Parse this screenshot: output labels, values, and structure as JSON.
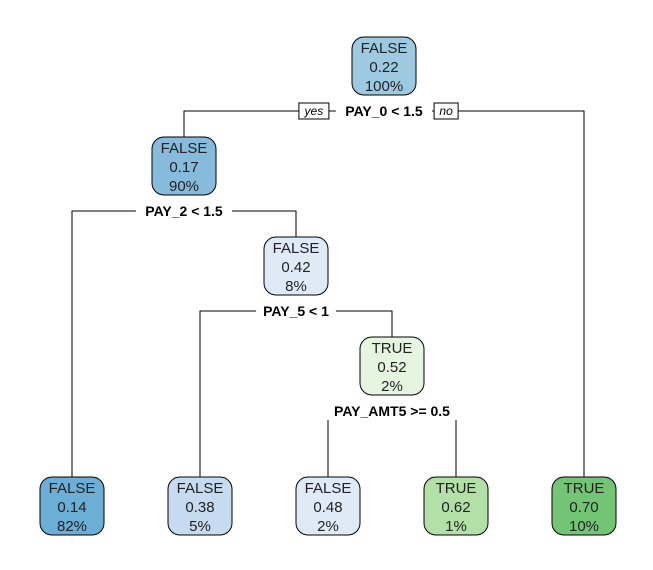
{
  "diagram": {
    "type": "decision-tree",
    "edge_labels": {
      "left": "yes",
      "right": "no"
    },
    "colors": {
      "false_1": "#6baed6",
      "false_2": "#86bbdc",
      "false_3": "#9ecae1",
      "false_4": "#c6dbef",
      "false_5": "#d0e1f2",
      "false_6": "#deebf7",
      "true_1": "#e5f5e0",
      "true_2": "#b3e0a6",
      "true_3": "#74c476"
    },
    "nodes": [
      {
        "id": "n1",
        "class": "FALSE",
        "prob": "0.22",
        "pct": "100%",
        "color": "false_3",
        "split": "PAY_0 < 1.5"
      },
      {
        "id": "n2",
        "class": "FALSE",
        "prob": "0.17",
        "pct": "90%",
        "color": "false_2",
        "split": "PAY_2 < 1.5"
      },
      {
        "id": "n3",
        "class": "TRUE",
        "prob": "0.70",
        "pct": "10%",
        "color": "true_3"
      },
      {
        "id": "n4",
        "class": "FALSE",
        "prob": "0.14",
        "pct": "82%",
        "color": "false_1"
      },
      {
        "id": "n5",
        "class": "FALSE",
        "prob": "0.42",
        "pct": "8%",
        "color": "false_6",
        "split": "PAY_5 < 1"
      },
      {
        "id": "n10",
        "class": "FALSE",
        "prob": "0.38",
        "pct": "5%",
        "color": "false_4"
      },
      {
        "id": "n11",
        "class": "TRUE",
        "prob": "0.52",
        "pct": "2%",
        "color": "true_1",
        "split": "PAY_AMT5 >= 0.5"
      },
      {
        "id": "n22",
        "class": "FALSE",
        "prob": "0.48",
        "pct": "2%",
        "color": "false_6"
      },
      {
        "id": "n23",
        "class": "TRUE",
        "prob": "0.62",
        "pct": "1%",
        "color": "true_2"
      }
    ],
    "edges": [
      {
        "from": "n1",
        "to": "n2"
      },
      {
        "from": "n1",
        "to": "n3"
      },
      {
        "from": "n2",
        "to": "n4"
      },
      {
        "from": "n2",
        "to": "n5"
      },
      {
        "from": "n5",
        "to": "n10"
      },
      {
        "from": "n5",
        "to": "n11"
      },
      {
        "from": "n11",
        "to": "n22"
      },
      {
        "from": "n11",
        "to": "n23"
      }
    ]
  }
}
